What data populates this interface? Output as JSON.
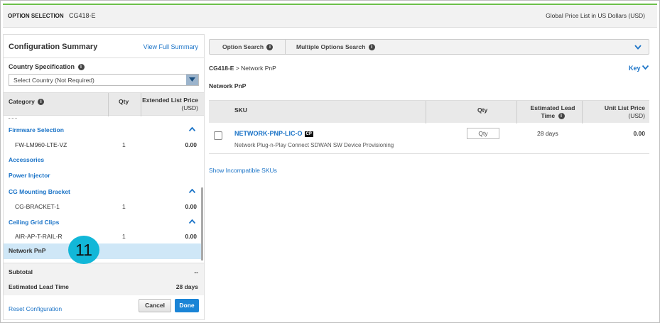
{
  "header": {
    "title": "OPTION SELECTION",
    "model": "CG418-E",
    "price_list": "Global Price List in US Dollars (USD)"
  },
  "summary": {
    "title": "Configuration Summary",
    "view_full": "View Full Summary",
    "country_label": "Country Specification",
    "country_select": "Select Country (Not Required)",
    "columns": {
      "category": "Category",
      "qty": "Qty",
      "price": "Extended List Price",
      "price_unit": "(USD)"
    },
    "rows": [
      {
        "name": "Firmware Selection",
        "kind": "group"
      },
      {
        "name": "FW-LM960-LTE-VZ",
        "kind": "item",
        "qty": "1",
        "price": "0.00"
      },
      {
        "name": "Accessories",
        "kind": "group"
      },
      {
        "name": "Power Injector",
        "kind": "group"
      },
      {
        "name": "CG Mounting Bracket",
        "kind": "group"
      },
      {
        "name": "CG-BRACKET-1",
        "kind": "item",
        "qty": "1",
        "price": "0.00"
      },
      {
        "name": "Ceiling Grid Clips",
        "kind": "group"
      },
      {
        "name": "AIR-AP-T-RAIL-R",
        "kind": "item",
        "qty": "1",
        "price": "0.00"
      },
      {
        "name": "Network PnP",
        "kind": "selected"
      }
    ],
    "subtotal_label": "Subtotal",
    "subtotal_value": "--",
    "lead_label": "Estimated Lead Time",
    "lead_value": "28 days",
    "reset": "Reset Configuration",
    "cancel": "Cancel",
    "done": "Done"
  },
  "callout": "11",
  "main": {
    "tabs": [
      "Option Search",
      "Multiple Options Search"
    ],
    "breadcrumb_root": "CG418-E",
    "breadcrumb_sep": ">",
    "breadcrumb_leaf": "Network PnP",
    "key": "Key",
    "section_title": "Network PnP",
    "columns": {
      "sku": "SKU",
      "qty": "Qty",
      "lead": "Estimated Lead Time",
      "price": "Unit List Price",
      "price_unit": "(USD)"
    },
    "row": {
      "sku": "NETWORK-PNP-LIC-O",
      "badge": "CP",
      "description": "Network Plug-n-Play Connect SDWAN SW Device Provisioning",
      "qty_placeholder": "Qty",
      "lead": "28 days",
      "price": "0.00"
    },
    "show_incompatible": "Show Incompatible SKUs"
  },
  "colors": {
    "accent": "#1a73c7",
    "green_bar": "#6cc04a",
    "done_button": "#1a84d6",
    "selected_row": "#cfe7f7",
    "callout": "#12b7d8"
  }
}
